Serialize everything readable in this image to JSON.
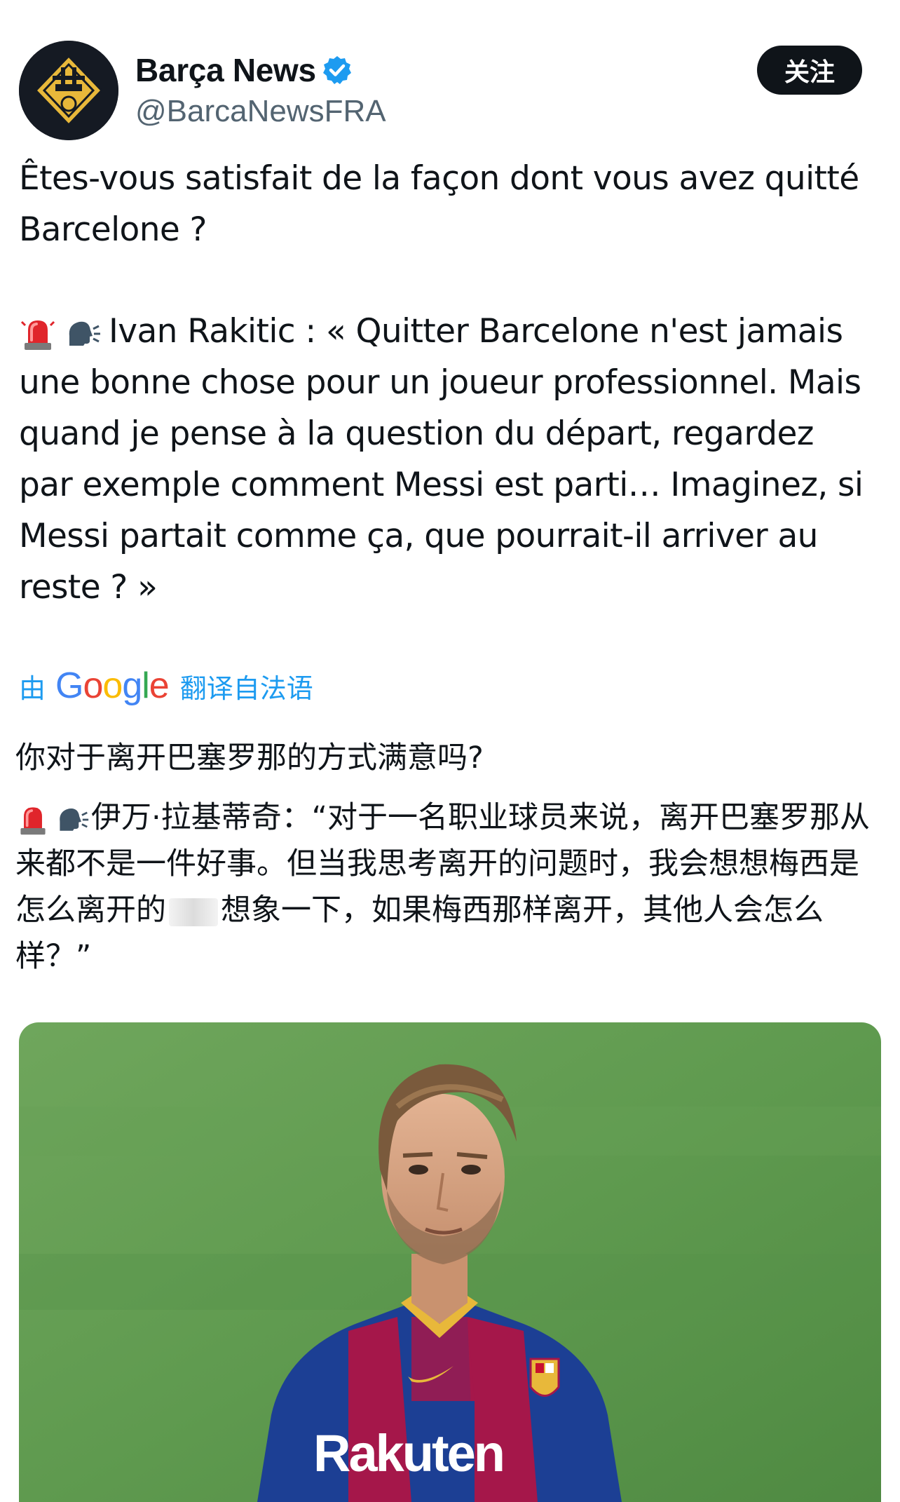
{
  "account": {
    "display_name": "Barça News",
    "handle": "@BarcaNewsFRA",
    "verified_icon": "verified-badge-icon",
    "avatar_icon": "barca-news-crest-logo"
  },
  "follow_button": {
    "label": "关注"
  },
  "tweet": {
    "paragraph1": "Êtes-vous satisfait de la façon dont vous avez quitté Barcelone ?",
    "paragraph2_emojis": [
      "police-light-emoji",
      "speaking-head-emoji"
    ],
    "paragraph2": "Ivan Rakitic : « Quitter Barcelone n'est jamais une bonne chose pour un joueur professionnel. Mais quand je pense à la question du départ, regardez par exemple comment Messi est parti… Imaginez, si Messi partait comme ça, que pourrait-il arriver au reste ? »"
  },
  "translation": {
    "by_label": "由",
    "provider": "Google",
    "provider_letters": [
      "G",
      "o",
      "o",
      "g",
      "l",
      "e"
    ],
    "translate_label": "翻译自法语",
    "zh_paragraph1": "你对于离开巴塞罗那的方式满意吗?",
    "zh_paragraph2_part1": "伊万·拉基蒂奇：“对于一名职业球员来说，离开巴塞罗那从来都不是一件好事。但当我思考离开的问题时，我会想想梅西是怎么离开的",
    "zh_paragraph2_part2": "想象一下，如果梅西那样离开，其他人会怎么样？”"
  },
  "media": {
    "description_icon": "player-photo-image",
    "shirt_sponsor": "Rakuten"
  },
  "colors": {
    "text": "#0f1419",
    "secondary_text": "#536471",
    "link_blue": "#1d9bf0",
    "follow_bg": "#0f1419",
    "pitch_green": "#5f9a4f"
  }
}
